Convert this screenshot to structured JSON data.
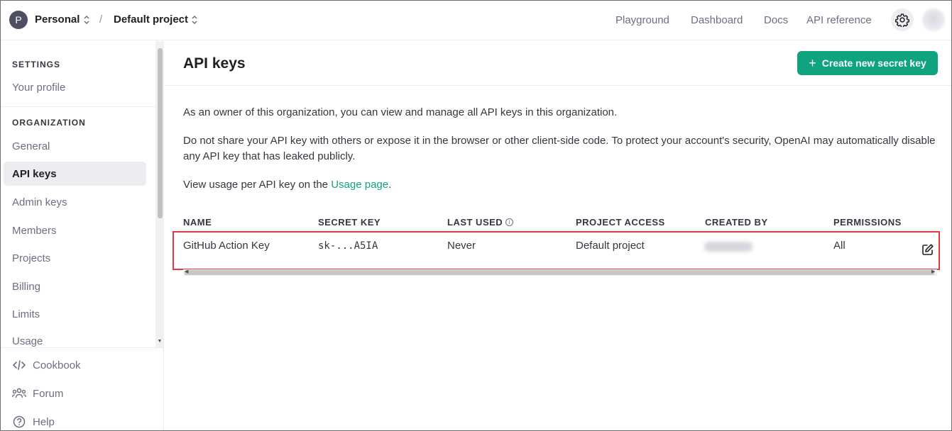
{
  "topbar": {
    "org_initial": "P",
    "org_name": "Personal",
    "separator": "/",
    "project_name": "Default project",
    "nav": [
      "Playground",
      "Dashboard",
      "Docs",
      "API reference"
    ]
  },
  "sidebar": {
    "settings_heading": "SETTINGS",
    "your_profile": "Your profile",
    "organization_heading": "ORGANIZATION",
    "items": [
      "General",
      "API keys",
      "Admin keys",
      "Members",
      "Projects",
      "Billing",
      "Limits",
      "Usage"
    ],
    "active_item": "API keys",
    "footer": [
      "Cookbook",
      "Forum",
      "Help"
    ]
  },
  "main": {
    "title": "API keys",
    "create_button": "Create new secret key",
    "para1": "As an owner of this organization, you can view and manage all API keys in this organization.",
    "para2": "Do not share your API key with others or expose it in the browser or other client-side code. To protect your account's security, OpenAI may automatically disable any API key that has leaked publicly.",
    "para3_prefix": "View usage per API key on the ",
    "para3_link": "Usage page",
    "para3_suffix": ".",
    "table": {
      "headers": [
        "NAME",
        "SECRET KEY",
        "LAST USED",
        "PROJECT ACCESS",
        "CREATED BY",
        "PERMISSIONS"
      ],
      "rows": [
        {
          "name": "GitHub Action Key",
          "secret_key": "sk-...A5IA",
          "last_used": "Never",
          "project_access": "Default project",
          "created_by": "",
          "permissions": "All"
        }
      ]
    }
  },
  "colors": {
    "accent": "#10a37f",
    "highlight_border": "#e0393e",
    "active_bg": "#ececf1"
  }
}
